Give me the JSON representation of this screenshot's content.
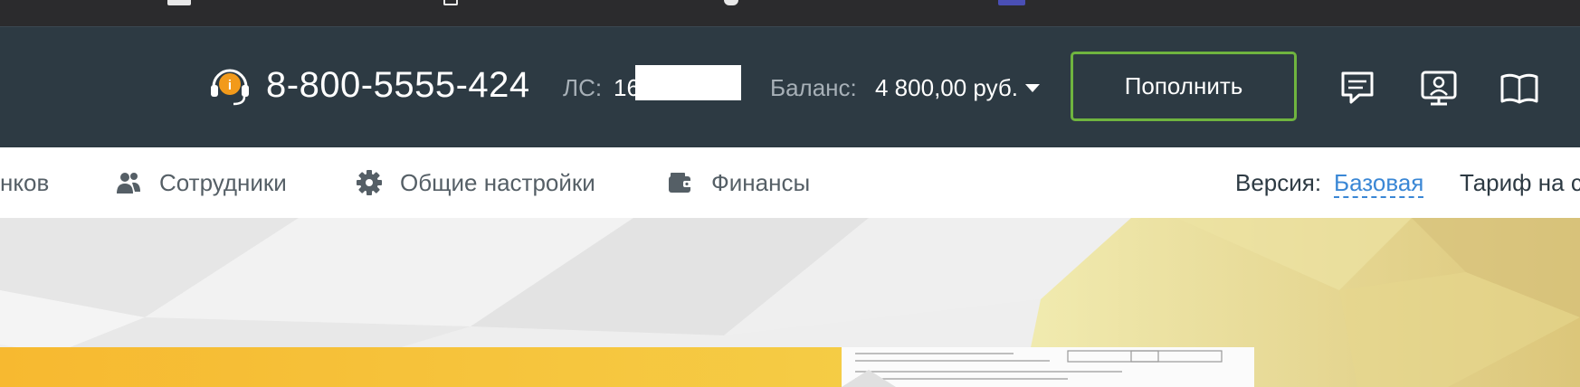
{
  "header": {
    "phone": "8-800-5555-424",
    "account_label": "ЛС:",
    "account_value": "16",
    "balance_label": "Баланс:",
    "balance_value": "4 800,00 руб.",
    "topup_label": "Пополнить"
  },
  "nav": {
    "items": [
      {
        "label": "нков",
        "icon": "none"
      },
      {
        "label": "Сотрудники",
        "icon": "users-icon"
      },
      {
        "label": "Общие настройки",
        "icon": "gear-icon"
      },
      {
        "label": "Финансы",
        "icon": "wallet-icon"
      }
    ],
    "version_label": "Версия:",
    "version_value": "Базовая",
    "tariff_label": "Тариф на с"
  },
  "colors": {
    "header_bg": "#2d3a43",
    "accent_green": "#6fb43f",
    "link_blue": "#3a87d5",
    "support_orange": "#f29a1b"
  }
}
